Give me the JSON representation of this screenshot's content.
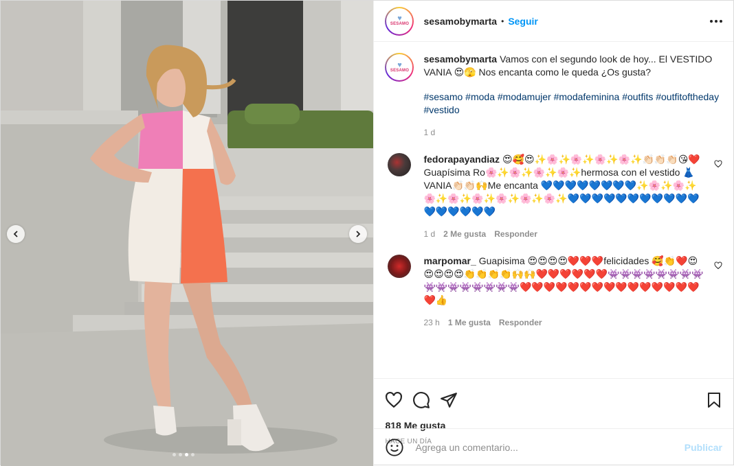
{
  "post": {
    "author": "sesamobymarta",
    "follow_label": "Seguir",
    "bullet": "•",
    "avatar_brand": "SESAMO"
  },
  "caption": {
    "username": "sesamobymarta",
    "text": "Vamos con el segundo look de hoy... El VESTIDO VANIA 😍🫣 Nos encanta como le queda ¿Os gusta?",
    "hashtags": "#sesamo #moda #modamujer #modafeminina #outfits #outfitoftheday #vestido",
    "age": "1 d"
  },
  "comments": [
    {
      "username": "fedorapayandiaz",
      "text": "😍🥰😍✨🌸✨🌸✨🌸✨🌸✨👏🏻👏🏻👏🏻😘❤️ Guapísima Ro🌸✨🌸✨🌸✨🌸✨hermosa con el vestido 👗 VANIA👏🏻👏🏻🙌Me encanta 💙💙💙💙💙💙💙💙✨🌸✨🌸✨🌸✨🌸✨🌸✨🌸✨🌸✨🌸✨💙💙💙💙💙💙💙💙💙💙💙💙💙💙💙💙💙",
      "age": "1 d",
      "likes": "2 Me gusta",
      "reply": "Responder"
    },
    {
      "username": "marpomar_",
      "text": "Guapisima 😍😍😍😍❤️❤️❤️felicidades 🥰👏❤️😍😍😍😍😍👏👏👏👏🙌🙌❤️❤️❤️❤️❤️❤️👾👾👾👾👾👾👾👾👾👾👾👾👾👾👾👾❤️❤️❤️❤️❤️❤️❤️❤️❤️❤️❤️❤️❤️❤️❤️❤️👍",
      "age": "23 h",
      "likes": "1 Me gusta",
      "reply": "Responder"
    }
  ],
  "actions": {
    "likes_count": "818 Me gusta",
    "timestamp": "HACE UN DÍA"
  },
  "composer": {
    "placeholder": "Agrega un comentario...",
    "publish": "Publicar"
  },
  "icons": {
    "like": "heart-icon",
    "comment": "comment-icon",
    "share": "paper-plane-icon",
    "save": "bookmark-icon",
    "emoji": "smiley-icon",
    "more": "more-options-icon",
    "prev": "chevron-left-icon",
    "next": "chevron-right-icon"
  },
  "colors": {
    "accent": "#0095f6",
    "hashtag": "#00376b",
    "muted": "#8e8e8e",
    "publish_disabled": "#b2dffc"
  },
  "carousel": {
    "slide_count": 4,
    "active_slide": 3
  }
}
